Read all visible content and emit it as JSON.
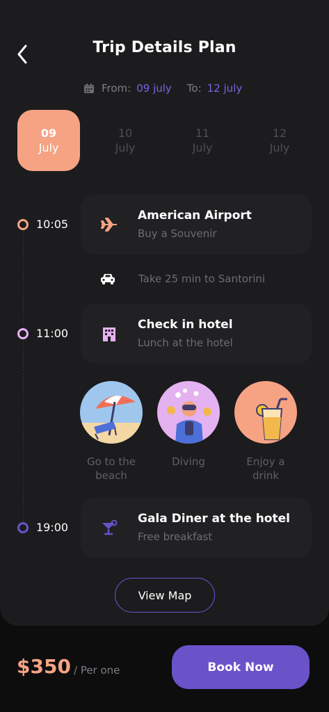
{
  "header": {
    "title": "Trip Details Plan",
    "back_icon": "chevron-left-icon"
  },
  "dates": {
    "from_label": "From:",
    "from_value": "09 july",
    "to_label": "To:",
    "to_value": "12 july",
    "icon": "calendar-icon"
  },
  "days": [
    {
      "num": "09",
      "month": "July",
      "active": true
    },
    {
      "num": "10",
      "month": "July",
      "active": false
    },
    {
      "num": "11",
      "month": "July",
      "active": false
    },
    {
      "num": "12",
      "month": "July",
      "active": false
    }
  ],
  "timeline": [
    {
      "time": "10:05",
      "title": "American Airport",
      "subtitle": "Buy a Souvenir",
      "icon": "airplane-icon",
      "dot_color": "#f6a384"
    },
    {
      "time": "11:00",
      "title": "Check in hotel",
      "subtitle": "Lunch at the hotel",
      "icon": "hotel-icon",
      "dot_color": "#e8b0f5"
    },
    {
      "time": "19:00",
      "title": "Gala Diner at the hotel",
      "subtitle": "Free breakfast",
      "icon": "cocktail-icon",
      "dot_color": "#6a52c9"
    }
  ],
  "transfer": {
    "text": "Take 25 min to Santorini",
    "icon": "car-icon"
  },
  "activities": [
    {
      "label": "Go to the beach",
      "icon": "beach-umbrella-icon"
    },
    {
      "label": "Diving",
      "icon": "diver-icon"
    },
    {
      "label": "Enjoy a drink",
      "icon": "drink-icon"
    }
  ],
  "map_button": "View Map",
  "footer": {
    "price": "$350",
    "per": "/ Per one",
    "book_label": "Book Now"
  },
  "colors": {
    "accent": "#6a52c9",
    "peach": "#f6a384",
    "bg": "#1c1c1e"
  }
}
